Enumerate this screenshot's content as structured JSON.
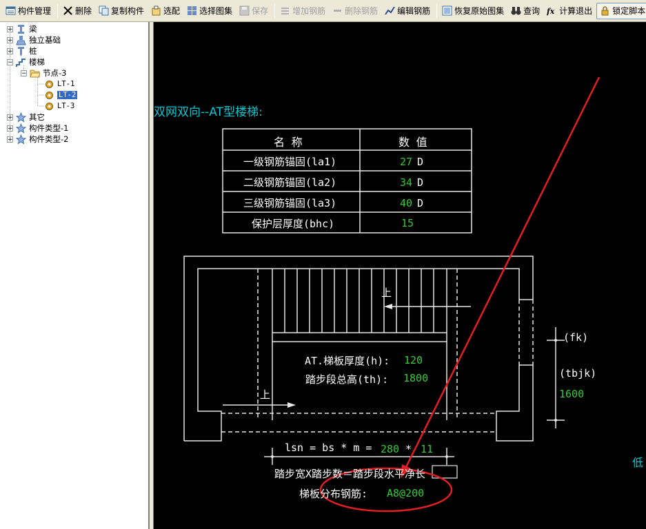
{
  "toolbar": {
    "items": [
      {
        "label": "构件管理",
        "icon": "component-manage-icon",
        "enabled": true
      },
      {
        "label": "删除",
        "icon": "delete-x-icon",
        "enabled": true
      },
      {
        "label": "复制构件",
        "icon": "copy-icon",
        "enabled": true
      },
      {
        "label": "选配",
        "icon": "select-config-icon",
        "enabled": true
      },
      {
        "label": "选择图集",
        "icon": "select-atlas-icon",
        "enabled": true
      },
      {
        "label": "保存",
        "icon": "save-icon",
        "enabled": false
      },
      {
        "label": "增加钢筋",
        "icon": "add-rebar-icon",
        "enabled": false
      },
      {
        "label": "删除钢筋",
        "icon": "delete-rebar-icon",
        "enabled": false
      },
      {
        "label": "编辑钢筋",
        "icon": "edit-rebar-icon",
        "enabled": true
      },
      {
        "label": "恢复原始图集",
        "icon": "restore-atlas-icon",
        "enabled": true
      },
      {
        "label": "查询",
        "icon": "binoculars-icon",
        "enabled": true
      },
      {
        "label": "计算退出",
        "icon": "fx-icon",
        "enabled": true
      },
      {
        "label": "锁定脚本",
        "icon": "lock-icon",
        "enabled": true
      }
    ]
  },
  "tree": {
    "items": [
      {
        "label": "梁",
        "level": 0,
        "expander": "+",
        "icon": "beam-icon"
      },
      {
        "label": "独立基础",
        "level": 0,
        "expander": "+",
        "icon": "foundation-icon"
      },
      {
        "label": "桩",
        "level": 0,
        "expander": "+",
        "icon": "pile-icon"
      },
      {
        "label": "楼梯",
        "level": 0,
        "expander": "-",
        "icon": "stair-icon"
      },
      {
        "label": "节点-3",
        "level": 1,
        "expander": "-",
        "icon": "folder-open-icon"
      },
      {
        "label": "LT-1",
        "level": 2,
        "expander": "",
        "icon": "gear-icon"
      },
      {
        "label": "LT-2",
        "level": 2,
        "expander": "",
        "icon": "gear-icon",
        "selected": true
      },
      {
        "label": "LT-3",
        "level": 2,
        "expander": "",
        "icon": "gear-icon"
      },
      {
        "label": "其它",
        "level": 0,
        "expander": "+",
        "icon": "star-icon"
      },
      {
        "label": "构件类型-1",
        "level": 0,
        "expander": "+",
        "icon": "star-icon"
      },
      {
        "label": "构件类型-2",
        "level": 0,
        "expander": "+",
        "icon": "star-icon"
      }
    ]
  },
  "drawing": {
    "title": "双网双向--AT型楼梯:",
    "table": {
      "headers": [
        "名  称",
        "数  值"
      ],
      "rows": [
        {
          "name": "一级钢筋锚固(la1)",
          "value": "27",
          "unit": "D"
        },
        {
          "name": "二级钢筋锚固(la2)",
          "value": "34",
          "unit": "D"
        },
        {
          "name": "三级钢筋锚固(la3)",
          "value": "40",
          "unit": "D"
        },
        {
          "name": "保护层厚度(bhc)",
          "value": "15",
          "unit": ""
        }
      ]
    },
    "up_label": "上",
    "thickness_label": "AT.梯板厚度(h):",
    "thickness_value": "120",
    "total_height_label": "踏步段总高(th):",
    "total_height_value": "1800",
    "fk_label": "(fk)",
    "tbjk_label": "(tbjk)",
    "tbjk_value": "1600",
    "lsn_formula": "lsn = bs * m =",
    "bs_value": "280",
    "times": "*",
    "m_value": "11",
    "formula_text": "踏步宽X踏步数＝踏步段水平净长",
    "distribution_label": "梯板分布钢筋:",
    "distribution_value": "A8@200",
    "right_edge_text": "低",
    "colors": {
      "line": "#ffffff",
      "value": "#33cc33",
      "title": "#00c8d2",
      "annotation": "#e31e24"
    }
  }
}
